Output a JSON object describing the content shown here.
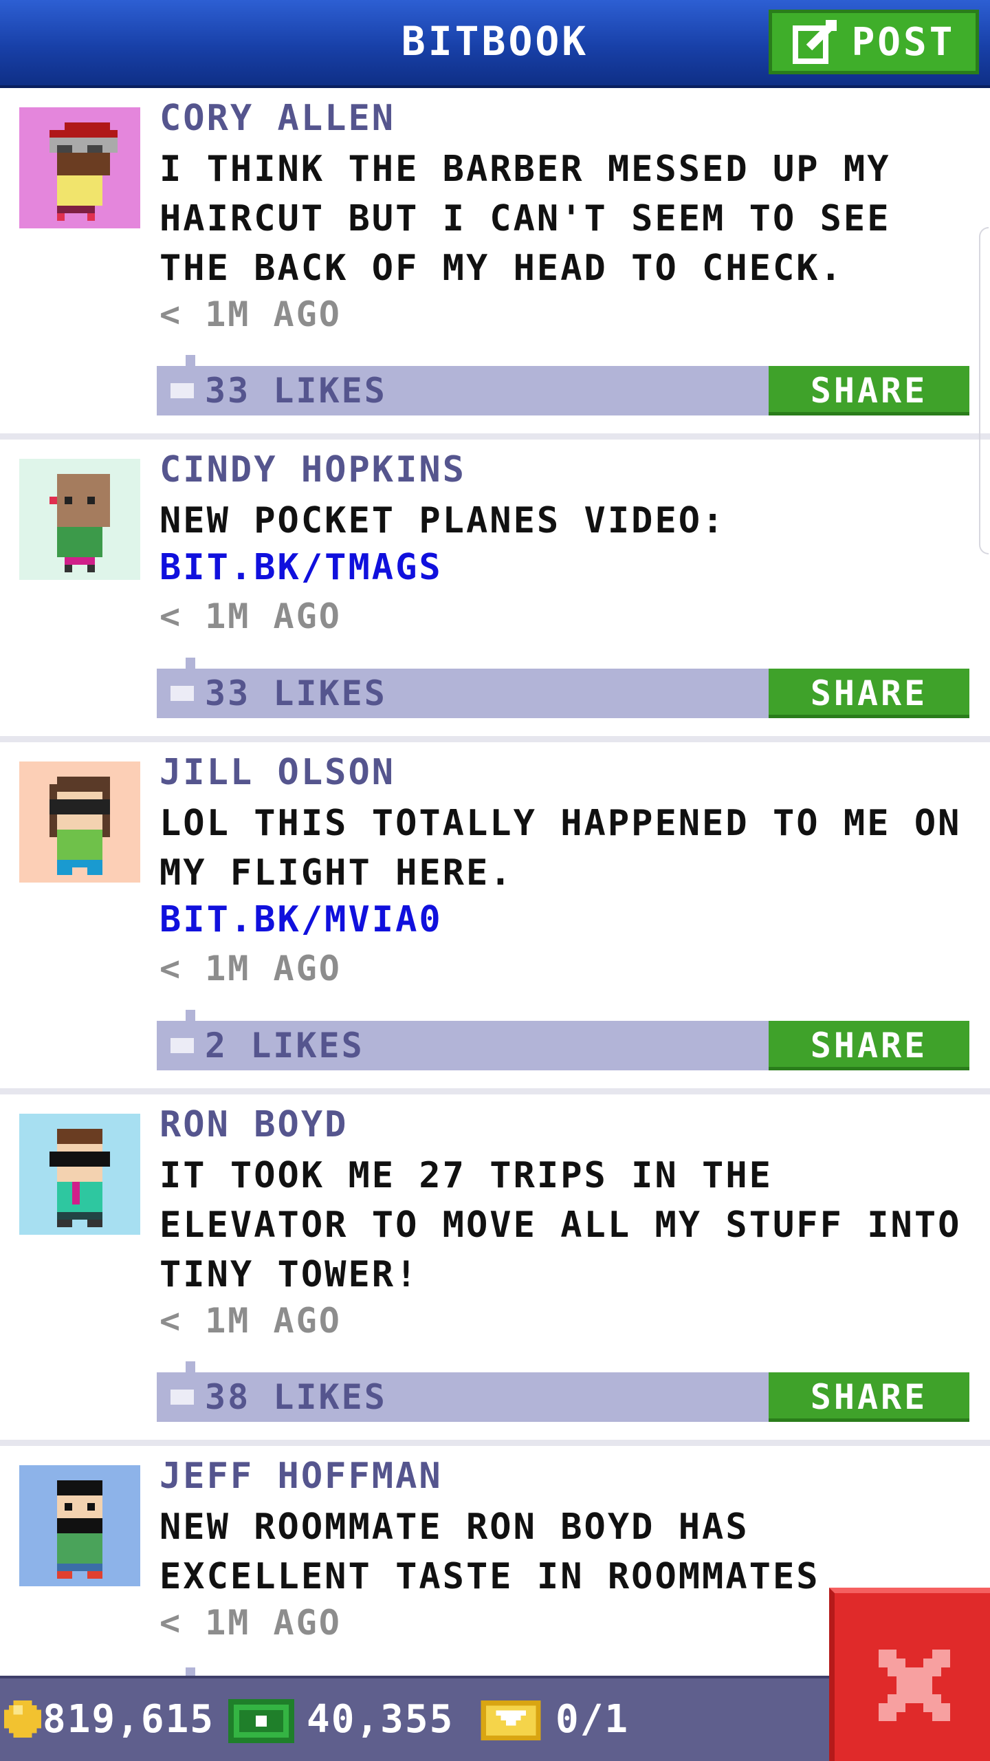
{
  "header": {
    "title": "BITBOOK",
    "post_label": "POST"
  },
  "posts": [
    {
      "name": "CORY ALLEN",
      "message": "I THINK THE BARBER MESSED UP MY HAIRCUT BUT I CAN'T SEEM TO SEE THE BACK OF MY HEAD TO CHECK.",
      "link": "",
      "time": "< 1M AGO",
      "likes": "33 LIKES",
      "share": "SHARE",
      "avatar_bg": "#e486dc"
    },
    {
      "name": "CINDY HOPKINS",
      "message": "NEW POCKET PLANES VIDEO:",
      "link": "BIT.BK/TMAGS",
      "time": "< 1M AGO",
      "likes": "33 LIKES",
      "share": "SHARE",
      "avatar_bg": "#dff5ea"
    },
    {
      "name": "JILL OLSON",
      "message": "LOL THIS TOTALLY HAPPENED TO ME ON MY FLIGHT HERE.",
      "link": "BIT.BK/MVIA0",
      "time": "< 1M AGO",
      "likes": "2 LIKES",
      "share": "SHARE",
      "avatar_bg": "#fccfb6"
    },
    {
      "name": "RON BOYD",
      "message": "IT TOOK ME 27 TRIPS IN THE ELEVATOR TO MOVE ALL MY STUFF INTO TINY TOWER!",
      "link": "",
      "time": "< 1M AGO",
      "likes": "38 LIKES",
      "share": "SHARE",
      "avatar_bg": "#a7dff1"
    },
    {
      "name": "JEFF HOFFMAN",
      "message": "NEW ROOMMATE RON BOYD HAS EXCELLENT TASTE IN ROOMMATES",
      "link": "",
      "time": "< 1M AGO",
      "likes": "",
      "share": "",
      "avatar_bg": "#8db3e9"
    }
  ],
  "footer": {
    "coins": "819,615",
    "bux": "40,355",
    "tickets": "0/1"
  },
  "colors": {
    "header": "#1a46b5",
    "post_button": "#3fae2a",
    "share_button": "#3fa22a",
    "like_bar": "#b2b4d7",
    "name_text": "#55558e",
    "link_text": "#1010dd",
    "footer": "#5f5f8d",
    "close_button": "#e02a2a"
  }
}
